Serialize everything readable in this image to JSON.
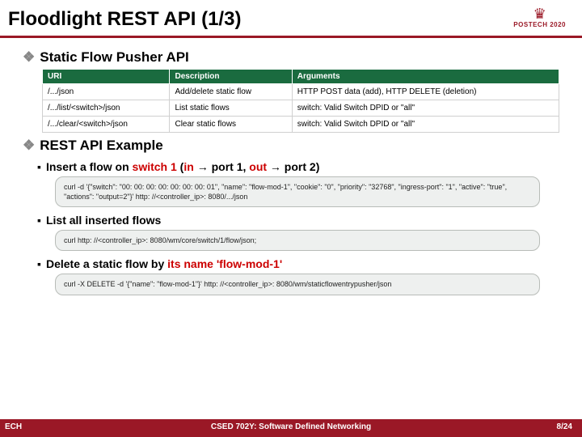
{
  "title": "Floodlight REST API (1/3)",
  "logo": {
    "name": "POSTECH",
    "year": "2020"
  },
  "section1": {
    "heading": "Static Flow Pusher API",
    "table": {
      "headers": [
        "URI",
        "Description",
        "Arguments"
      ],
      "rows": [
        [
          "/.../json",
          "Add/delete static flow",
          "HTTP POST data (add), HTTP DELETE (deletion)"
        ],
        [
          "/.../list/<switch>/json",
          "List static flows",
          "switch: Valid Switch DPID or \"all\""
        ],
        [
          "/.../clear/<switch>/json",
          "Clear static flows",
          "switch: Valid Switch DPID or \"all\""
        ]
      ]
    }
  },
  "section2": {
    "heading": "REST API Example",
    "item1": {
      "pre": "Insert a flow on ",
      "sw": "switch 1",
      "mid1": " (",
      "in": "in",
      "mid2": " → port 1, ",
      "out": "out",
      "mid3": " → port 2)",
      "code": "curl -d '{\"switch\": \"00: 00: 00: 00: 00: 00: 00: 01\", \"name\": \"flow-mod-1\", \"cookie\": \"0\", \"priority\": \"32768\", \"ingress-port\": \"1\", \"active\": \"true\", \"actions\": \"output=2\"}' http: //<controller_ip>: 8080/.../json"
    },
    "item2": {
      "label": "List all inserted flows",
      "code": "curl http: //<controller_ip>: 8080/wm/core/switch/1/flow/json;"
    },
    "item3": {
      "pre": "Delete a static flow by ",
      "name": "its name 'flow-mod-1'",
      "code": "curl -X DELETE -d '{\"name\": \"flow-mod-1\"}' http: //<controller_ip>: 8080/wm/staticflowentrypusher/json"
    }
  },
  "footer": {
    "left": "ECH",
    "center": "CSED 702Y: Software Defined Networking",
    "right": "8/24"
  }
}
